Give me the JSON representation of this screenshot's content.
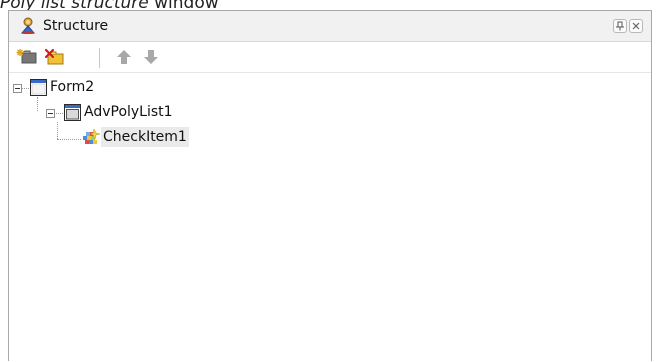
{
  "caption": {
    "bold": "Poly list structure",
    "rest": "window"
  },
  "panel": {
    "title": "Structure"
  },
  "toolbar": {
    "buttons": [
      {
        "icon": "add-item-icon"
      },
      {
        "icon": "delete-item-icon"
      },
      {
        "icon": "move-up-icon"
      },
      {
        "icon": "move-down-icon"
      }
    ]
  },
  "tree": {
    "nodes": [
      {
        "label": "Form2",
        "icon": "form-icon",
        "expanded": true,
        "level": 0
      },
      {
        "label": "AdvPolyList1",
        "icon": "polylist-icon",
        "expanded": true,
        "level": 1
      },
      {
        "label": "CheckItem1",
        "icon": "checkitem-icon",
        "expanded": false,
        "level": 2,
        "selected": true
      }
    ]
  }
}
